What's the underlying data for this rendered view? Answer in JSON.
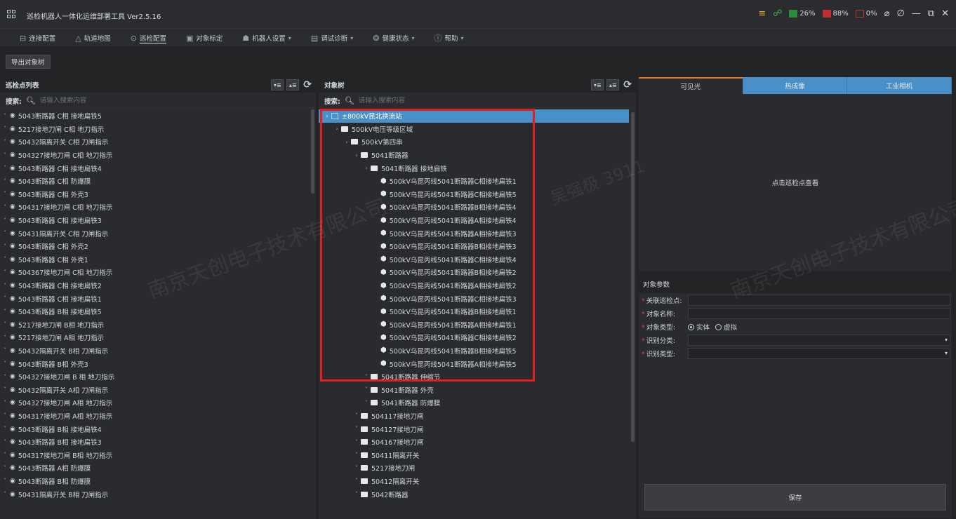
{
  "window": {
    "title": "巡检机器人一体化运维部署工具 Ver2.5.16",
    "tray": {
      "cpu": "26%",
      "memory": "88%",
      "disk": "0%"
    }
  },
  "colors": {
    "accent": "#4a90c8",
    "highlight": "#e02020",
    "tab_active_border": "#e07a20",
    "required": "#e04040"
  },
  "menu": [
    {
      "icon": "connection-icon",
      "label": "连接配置",
      "has_dropdown": false
    },
    {
      "icon": "map-icon",
      "label": "轨道地图",
      "has_dropdown": false
    },
    {
      "icon": "patrol-icon",
      "label": "巡检配置",
      "has_dropdown": false,
      "active": true
    },
    {
      "icon": "calibrate-icon",
      "label": "对象标定",
      "has_dropdown": false
    },
    {
      "icon": "robot-icon",
      "label": "机器人设置",
      "has_dropdown": true
    },
    {
      "icon": "debug-icon",
      "label": "调试诊断",
      "has_dropdown": true
    },
    {
      "icon": "health-icon",
      "label": "健康状态",
      "has_dropdown": true
    },
    {
      "icon": "help-icon",
      "label": "帮助",
      "has_dropdown": true
    }
  ],
  "toolbar": {
    "export_label": "导出对象树"
  },
  "left_panel": {
    "title": "巡检点列表",
    "search_label": "搜索:",
    "search_placeholder": "请输入搜索内容",
    "items": [
      "5043断路器 C相 接地扁铁5",
      "5217接地刀闸 C相 地刀指示",
      "50432隔离开关 C相 刀闸指示",
      "504327接地刀闸 C相 地刀指示",
      "5043断路器 C相 接地扁铁4",
      "5043断路器 C相 防爆膜",
      "5043断路器 C相 外壳3",
      "504317接地刀闸 C相 地刀指示",
      "5043断路器 C相 接地扁铁3",
      "50431隔离开关 C相 刀闸指示",
      "5043断路器 C相 外壳2",
      "5043断路器 C相 外壳1",
      "504367接地刀闸 C相 地刀指示",
      "5043断路器 C相 接地扁铁2",
      "5043断路器 C相 接地扁铁1",
      "5043断路器 B相 接地扁铁5",
      "5217接地刀闸 B相 地刀指示",
      "5217接地刀闸 A相 地刀指示",
      "50432隔离开关 B相 刀闸指示",
      "5043断路器 B相 外壳3",
      "504327接地刀闸 B 相 地刀指示",
      "50432隔离开关 A相 刀闸指示",
      "504327接地刀闸 A相 地刀指示",
      "504317接地刀闸 A相 地刀指示",
      "5043断路器 B相 接地扁铁4",
      "5043断路器 B相 接地扁铁3",
      "504317接地刀闸 B相 地刀指示",
      "5043断路器 A相 防爆膜",
      "5043断路器 B相 防爆膜",
      "50431隔离开关 B相 刀闸指示"
    ]
  },
  "tree_panel": {
    "title": "对象树",
    "search_label": "搜索:",
    "search_placeholder": "请输入搜索内容",
    "nodes": [
      {
        "label": "±800kV昆北换流站",
        "level": 0,
        "kind": "station",
        "chev": "›",
        "selected": true
      },
      {
        "label": "500kV电压等级区域",
        "level": 1,
        "kind": "folder",
        "chev": "›"
      },
      {
        "label": "500kV第四串",
        "level": 2,
        "kind": "folder",
        "chev": "›"
      },
      {
        "label": "5041断路器",
        "level": 3,
        "kind": "folder",
        "chev": "›"
      },
      {
        "label": "5041断路器 接地扁铁",
        "level": 4,
        "kind": "folder",
        "chev": "›"
      },
      {
        "label": "500kV乌昆丙线5041断路器C相接地扁铁1",
        "level": 5,
        "kind": "object",
        "chev": ""
      },
      {
        "label": "500kV乌昆丙线5041断路器C相接地扁铁5",
        "level": 5,
        "kind": "object",
        "chev": ""
      },
      {
        "label": "500kV乌昆丙线5041断路器B相接地扁铁4",
        "level": 5,
        "kind": "object",
        "chev": ""
      },
      {
        "label": "500kV乌昆丙线5041断路器A相接地扁铁4",
        "level": 5,
        "kind": "object",
        "chev": ""
      },
      {
        "label": "500kV乌昆丙线5041断路器A相接地扁铁3",
        "level": 5,
        "kind": "object",
        "chev": ""
      },
      {
        "label": "500kV乌昆丙线5041断路器B相接地扁铁3",
        "level": 5,
        "kind": "object",
        "chev": ""
      },
      {
        "label": "500kV乌昆丙线5041断路器C相接地扁铁4",
        "level": 5,
        "kind": "object",
        "chev": ""
      },
      {
        "label": "500kV乌昆丙线5041断路器B相接地扁铁2",
        "level": 5,
        "kind": "object",
        "chev": ""
      },
      {
        "label": "500kV乌昆丙线5041断路器A相接地扁铁2",
        "level": 5,
        "kind": "object",
        "chev": ""
      },
      {
        "label": "500kV乌昆丙线5041断路器C相接地扁铁3",
        "level": 5,
        "kind": "object",
        "chev": ""
      },
      {
        "label": "500kV乌昆丙线5041断路器B相接地扁铁1",
        "level": 5,
        "kind": "object",
        "chev": ""
      },
      {
        "label": "500kV乌昆丙线5041断路器A相接地扁铁1",
        "level": 5,
        "kind": "object",
        "chev": ""
      },
      {
        "label": "500kV乌昆丙线5041断路器C相接地扁铁2",
        "level": 5,
        "kind": "object",
        "chev": ""
      },
      {
        "label": "500kV乌昆丙线5041断路器B相接地扁铁5",
        "level": 5,
        "kind": "object",
        "chev": ""
      },
      {
        "label": "500kV乌昆丙线5041断路器A相接地扁铁5",
        "level": 5,
        "kind": "object",
        "chev": ""
      },
      {
        "label": "5041断路器 伸缩节",
        "level": 4,
        "kind": "folder",
        "chev": "˅"
      },
      {
        "label": "5041断路器 外壳",
        "level": 4,
        "kind": "folder",
        "chev": "˅"
      },
      {
        "label": "5041断路器 防爆膜",
        "level": 4,
        "kind": "folder",
        "chev": "˅"
      },
      {
        "label": "504117接地刀闸",
        "level": 3,
        "kind": "folder",
        "chev": "˅"
      },
      {
        "label": "504127接地刀闸",
        "level": 3,
        "kind": "folder",
        "chev": "˅"
      },
      {
        "label": "504167接地刀闸",
        "level": 3,
        "kind": "folder",
        "chev": "˅"
      },
      {
        "label": "50411隔离开关",
        "level": 3,
        "kind": "folder",
        "chev": "˅"
      },
      {
        "label": "5217接地刀闸",
        "level": 3,
        "kind": "folder",
        "chev": "˅"
      },
      {
        "label": "50412隔离开关",
        "level": 3,
        "kind": "folder",
        "chev": "˅"
      },
      {
        "label": "5042断路器",
        "level": 3,
        "kind": "folder",
        "chev": "˅"
      }
    ]
  },
  "camera": {
    "tabs": [
      "可见光",
      "热成像",
      "工业相机"
    ],
    "active_tab": 0,
    "placeholder": "点击巡检点查看"
  },
  "params": {
    "title": "对象参数",
    "fields": {
      "patrol_point": "关联巡检点:",
      "object_name": "对象名称:",
      "object_type": "对象类型:",
      "recog_category": "识别分类:",
      "recog_type": "识别类型:"
    },
    "type_options": {
      "entity": "实体",
      "virtual": "虚拟"
    },
    "save_label": "保存"
  },
  "watermarks": [
    "南京天创电子技术有限公司",
    "南京天创电子技术有限公司",
    "吴强极 3911"
  ]
}
